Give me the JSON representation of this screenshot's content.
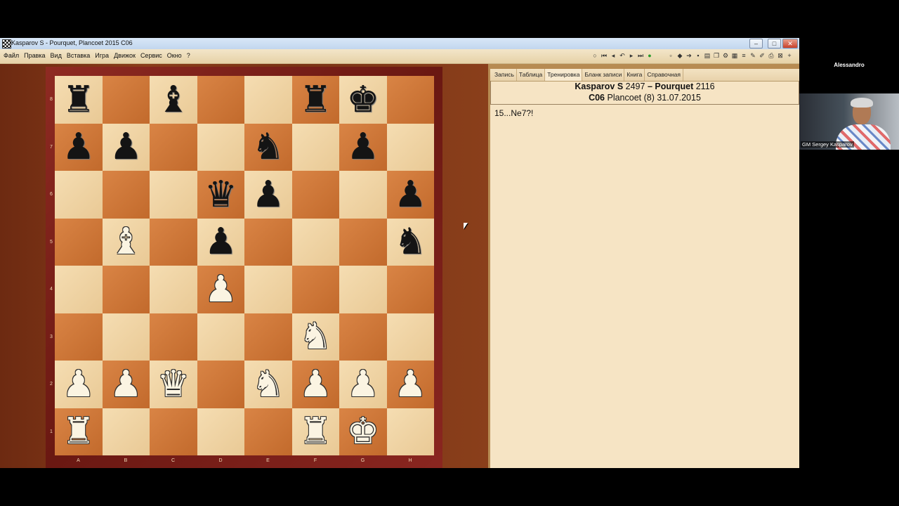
{
  "window": {
    "title": "Kasparov S - Pourquet, Plancoet 2015  C06"
  },
  "menu": [
    "Файл",
    "Правка",
    "Вид",
    "Вставка",
    "Игра",
    "Движок",
    "Сервис",
    "Окно",
    "?"
  ],
  "toolbar": {
    "nav_icons": [
      "circle-icon",
      "first-move-icon",
      "prev-move-icon",
      "undo-icon",
      "next-move-icon",
      "last-move-icon",
      "play-icon"
    ],
    "tool_icons": [
      "new-icon",
      "arrow-left-icon",
      "arrow-right-icon",
      "save-icon",
      "db-icon",
      "copy-icon",
      "settings-icon",
      "board-icon",
      "list-icon",
      "edit-icon",
      "pen-icon",
      "print-icon",
      "zoom-icon",
      "plus-icon"
    ]
  },
  "board": {
    "rank_labels": [
      "8",
      "7",
      "6",
      "5",
      "4",
      "3",
      "2",
      "1"
    ],
    "file_labels": [
      "A",
      "B",
      "C",
      "D",
      "E",
      "F",
      "G",
      "H"
    ],
    "position": [
      [
        "bR",
        "",
        "bB",
        "",
        "",
        "bR",
        "bK",
        ""
      ],
      [
        "bP",
        "bP",
        "",
        "",
        "bN",
        "",
        "bP",
        ""
      ],
      [
        "",
        "",
        "",
        "bQ",
        "bP",
        "",
        "",
        "bP"
      ],
      [
        "",
        "wB",
        "",
        "bP",
        "",
        "",
        "",
        "bN"
      ],
      [
        "",
        "",
        "",
        "wP",
        "",
        "",
        "",
        ""
      ],
      [
        "",
        "",
        "",
        "",
        "",
        "wN",
        "",
        ""
      ],
      [
        "wP",
        "wP",
        "wQ",
        "",
        "wN",
        "wP",
        "wP",
        "wP"
      ],
      [
        "wR",
        "",
        "",
        "",
        "",
        "wR",
        "wK",
        ""
      ]
    ]
  },
  "panel": {
    "tabs": [
      "Запись",
      "Таблица",
      "Тренировка",
      "Бланк записи",
      "Книга",
      "Справочная"
    ],
    "active_tab": "Тренировка",
    "white_player": "Kasparov S",
    "white_rating": "2497",
    "dash": "–",
    "black_player": "Pourquet",
    "black_rating": "2116",
    "eco": "C06",
    "event": "Plancoet (8) 31.07.2015",
    "notation": "15...Ne7?!"
  },
  "video": {
    "top_name": "Alessandro",
    "cam_name": "GM Sergey Kasparov"
  }
}
